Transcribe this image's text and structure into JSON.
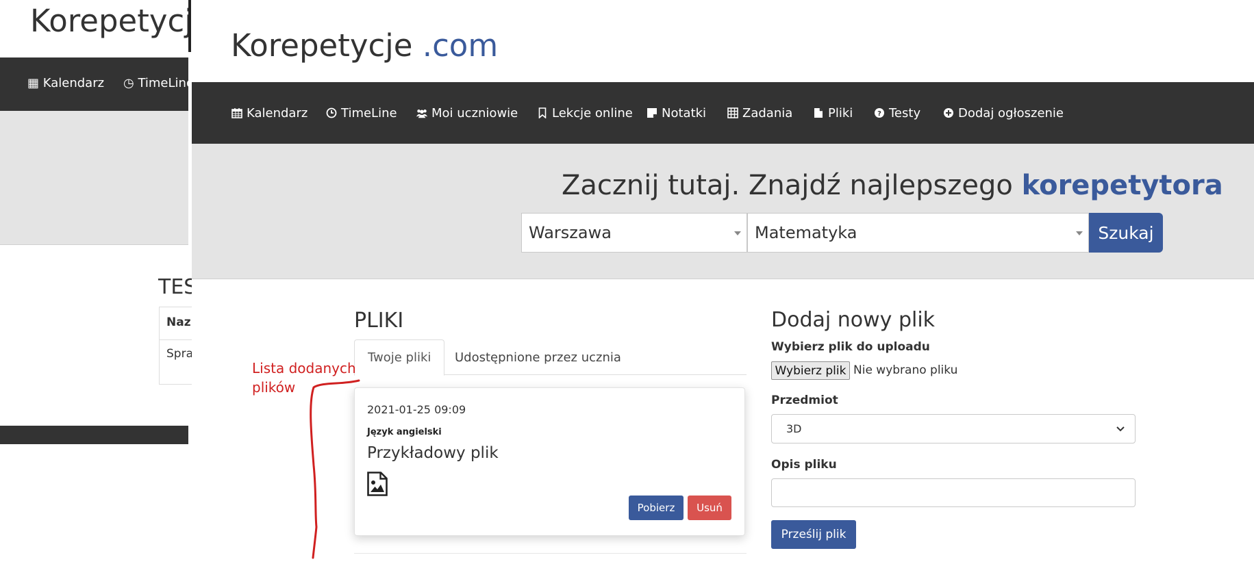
{
  "background_window": {
    "logo": "Korepetycje",
    "nav": [
      {
        "label": "Kalendarz",
        "icon": "calendar-icon"
      },
      {
        "label": "TimeLine",
        "icon": "clock-icon"
      }
    ],
    "section_title_partial": "TES",
    "table_header_partial": "Naz",
    "table_cell_partial": "Spra"
  },
  "logo": {
    "main": "Korepetycje ",
    "accent": ".com",
    "accent_color": "#3a5a9b"
  },
  "nav": {
    "items": [
      {
        "label": "Kalendarz",
        "icon": "calendar-icon"
      },
      {
        "label": "TimeLine",
        "icon": "clock-icon"
      },
      {
        "label": "Moi uczniowie",
        "icon": "users-icon"
      },
      {
        "label": "Lekcje online",
        "icon": "bookmark-icon"
      },
      {
        "label": "Notatki",
        "icon": "sticky-note-icon"
      },
      {
        "label": "Zadania",
        "icon": "table-icon"
      },
      {
        "label": "Pliki",
        "icon": "file-icon"
      },
      {
        "label": "Testy",
        "icon": "question-circle-icon"
      },
      {
        "label": "Dodaj ogłoszenie",
        "icon": "plus-circle-icon"
      }
    ]
  },
  "hero": {
    "title_prefix": "Zacznij tutaj. Znajdź najlepszego ",
    "title_highlight": "korepetytora",
    "city_value": "Warszawa",
    "subject_value": "Matematyka",
    "search_label": "Szukaj"
  },
  "files": {
    "title": "PLIKI",
    "tabs": [
      {
        "label": "Twoje pliki",
        "active": true
      },
      {
        "label": "Udostępnione przez ucznia",
        "active": false
      }
    ],
    "items": [
      {
        "date": "2021-01-25 09:09",
        "subject": "Język angielski",
        "name": "Przykładowy plik",
        "type_icon": "image-file-icon",
        "download_label": "Pobierz",
        "delete_label": "Usuń"
      }
    ]
  },
  "upload": {
    "title": "Dodaj nowy plik",
    "file_label": "Wybierz plik do uploadu",
    "choose_button": "Wybierz plik",
    "no_file_text": "Nie wybrano pliku",
    "subject_label": "Przedmiot",
    "subject_value": "3D",
    "description_label": "Opis pliku",
    "description_value": "",
    "submit_label": "Prześlij plik"
  },
  "annotation": {
    "line1": "Lista dodanych",
    "line2": "plików",
    "color": "#d02020"
  },
  "colors": {
    "brand": "#3a5a9b",
    "danger": "#d9534f",
    "navbar": "#333333",
    "hero_bg": "#e4e4e4"
  }
}
